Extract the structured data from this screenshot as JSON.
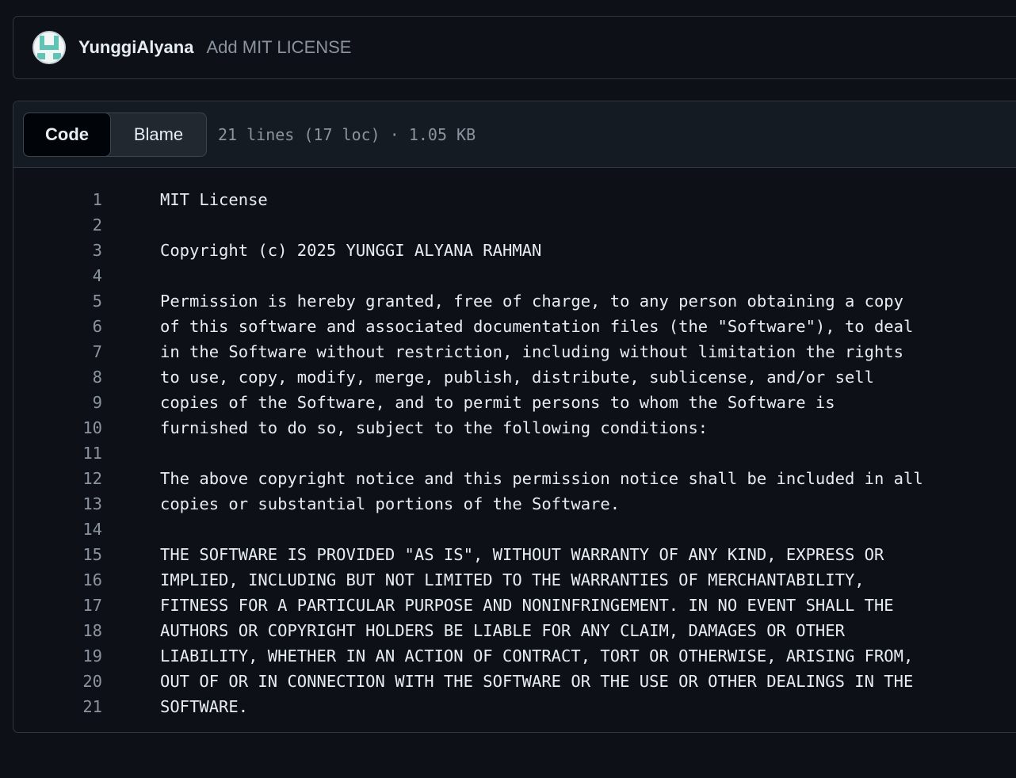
{
  "commit": {
    "author": "YunggiAlyana",
    "message": "Add MIT LICENSE",
    "avatar_icon": "identicon-avatar"
  },
  "file_header": {
    "tabs": [
      {
        "label": "Code",
        "active": true
      },
      {
        "label": "Blame",
        "active": false
      }
    ],
    "meta": "21 lines (17 loc) · 1.05 KB"
  },
  "code": {
    "lines": [
      {
        "num": "1",
        "text": "MIT License"
      },
      {
        "num": "2",
        "text": ""
      },
      {
        "num": "3",
        "text": "Copyright (c) 2025 YUNGGI ALYANA RAHMAN"
      },
      {
        "num": "4",
        "text": ""
      },
      {
        "num": "5",
        "text": "Permission is hereby granted, free of charge, to any person obtaining a copy"
      },
      {
        "num": "6",
        "text": "of this software and associated documentation files (the \"Software\"), to deal"
      },
      {
        "num": "7",
        "text": "in the Software without restriction, including without limitation the rights"
      },
      {
        "num": "8",
        "text": "to use, copy, modify, merge, publish, distribute, sublicense, and/or sell"
      },
      {
        "num": "9",
        "text": "copies of the Software, and to permit persons to whom the Software is"
      },
      {
        "num": "10",
        "text": "furnished to do so, subject to the following conditions:"
      },
      {
        "num": "11",
        "text": ""
      },
      {
        "num": "12",
        "text": "The above copyright notice and this permission notice shall be included in all"
      },
      {
        "num": "13",
        "text": "copies or substantial portions of the Software."
      },
      {
        "num": "14",
        "text": ""
      },
      {
        "num": "15",
        "text": "THE SOFTWARE IS PROVIDED \"AS IS\", WITHOUT WARRANTY OF ANY KIND, EXPRESS OR"
      },
      {
        "num": "16",
        "text": "IMPLIED, INCLUDING BUT NOT LIMITED TO THE WARRANTIES OF MERCHANTABILITY,"
      },
      {
        "num": "17",
        "text": "FITNESS FOR A PARTICULAR PURPOSE AND NONINFRINGEMENT. IN NO EVENT SHALL THE"
      },
      {
        "num": "18",
        "text": "AUTHORS OR COPYRIGHT HOLDERS BE LIABLE FOR ANY CLAIM, DAMAGES OR OTHER"
      },
      {
        "num": "19",
        "text": "LIABILITY, WHETHER IN AN ACTION OF CONTRACT, TORT OR OTHERWISE, ARISING FROM,"
      },
      {
        "num": "20",
        "text": "OUT OF OR IN CONNECTION WITH THE SOFTWARE OR THE USE OR OTHER DEALINGS IN THE"
      },
      {
        "num": "21",
        "text": "SOFTWARE."
      }
    ]
  },
  "colors": {
    "background": "#0d1117",
    "header_bg": "#151b23",
    "border": "#30363d",
    "text": "#e6edf3",
    "muted": "#8b949e",
    "avatar_teal": "#5fc3b5"
  }
}
